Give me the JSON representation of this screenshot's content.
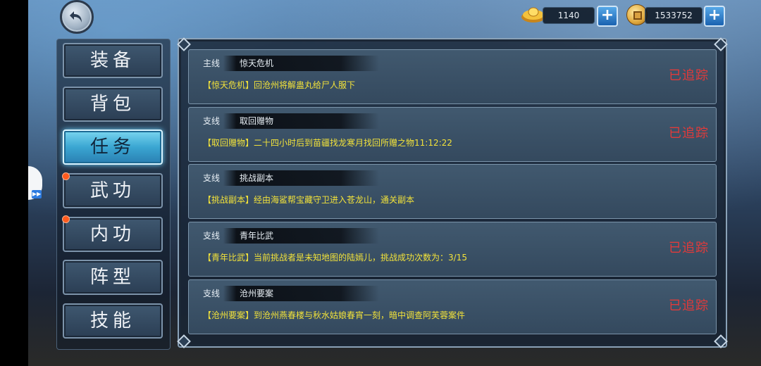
{
  "currency": {
    "gold": "1140",
    "coins": "1533752",
    "plus": "+"
  },
  "tabs": [
    {
      "label": "装备",
      "active": false,
      "dot": false
    },
    {
      "label": "背包",
      "active": false,
      "dot": false
    },
    {
      "label": "任务",
      "active": true,
      "dot": false
    },
    {
      "label": "武功",
      "active": false,
      "dot": true
    },
    {
      "label": "内功",
      "active": false,
      "dot": true
    },
    {
      "label": "阵型",
      "active": false,
      "dot": false
    },
    {
      "label": "技能",
      "active": false,
      "dot": false
    }
  ],
  "tasks": [
    {
      "type": "主线",
      "name": "惊天危机",
      "desc": "【惊天危机】回沧州将解蛊丸给尸人服下",
      "status": "已追踪"
    },
    {
      "type": "支线",
      "name": "取回赠物",
      "desc": "【取回赠物】二十四小时后到苗疆找龙寒月找回所赠之物11:12:22",
      "status": "已追踪"
    },
    {
      "type": "支线",
      "name": "挑战副本",
      "desc": "【挑战副本】经由海鲨帮宝藏守卫进入苍龙山，通关副本",
      "status": ""
    },
    {
      "type": "支线",
      "name": "青年比武",
      "desc": "【青年比武】当前挑战者是未知地图的陆嫣儿，挑战成功次数为：3/15",
      "status": "已追踪"
    },
    {
      "type": "支线",
      "name": "沧州要案",
      "desc": "【沧州要案】到沧州燕春楼与秋水姑娘春宵一刻，暗中调查阿芙蓉案件",
      "status": "已追踪"
    }
  ],
  "colors": {
    "status_red": "#e23a3a",
    "desc_yellow": "#f2e23a",
    "active_tab": "#3aa6d2"
  },
  "icons": {
    "back": "back-arrow-icon",
    "gold": "gold-ingot-icon",
    "coin": "copper-coin-icon"
  }
}
